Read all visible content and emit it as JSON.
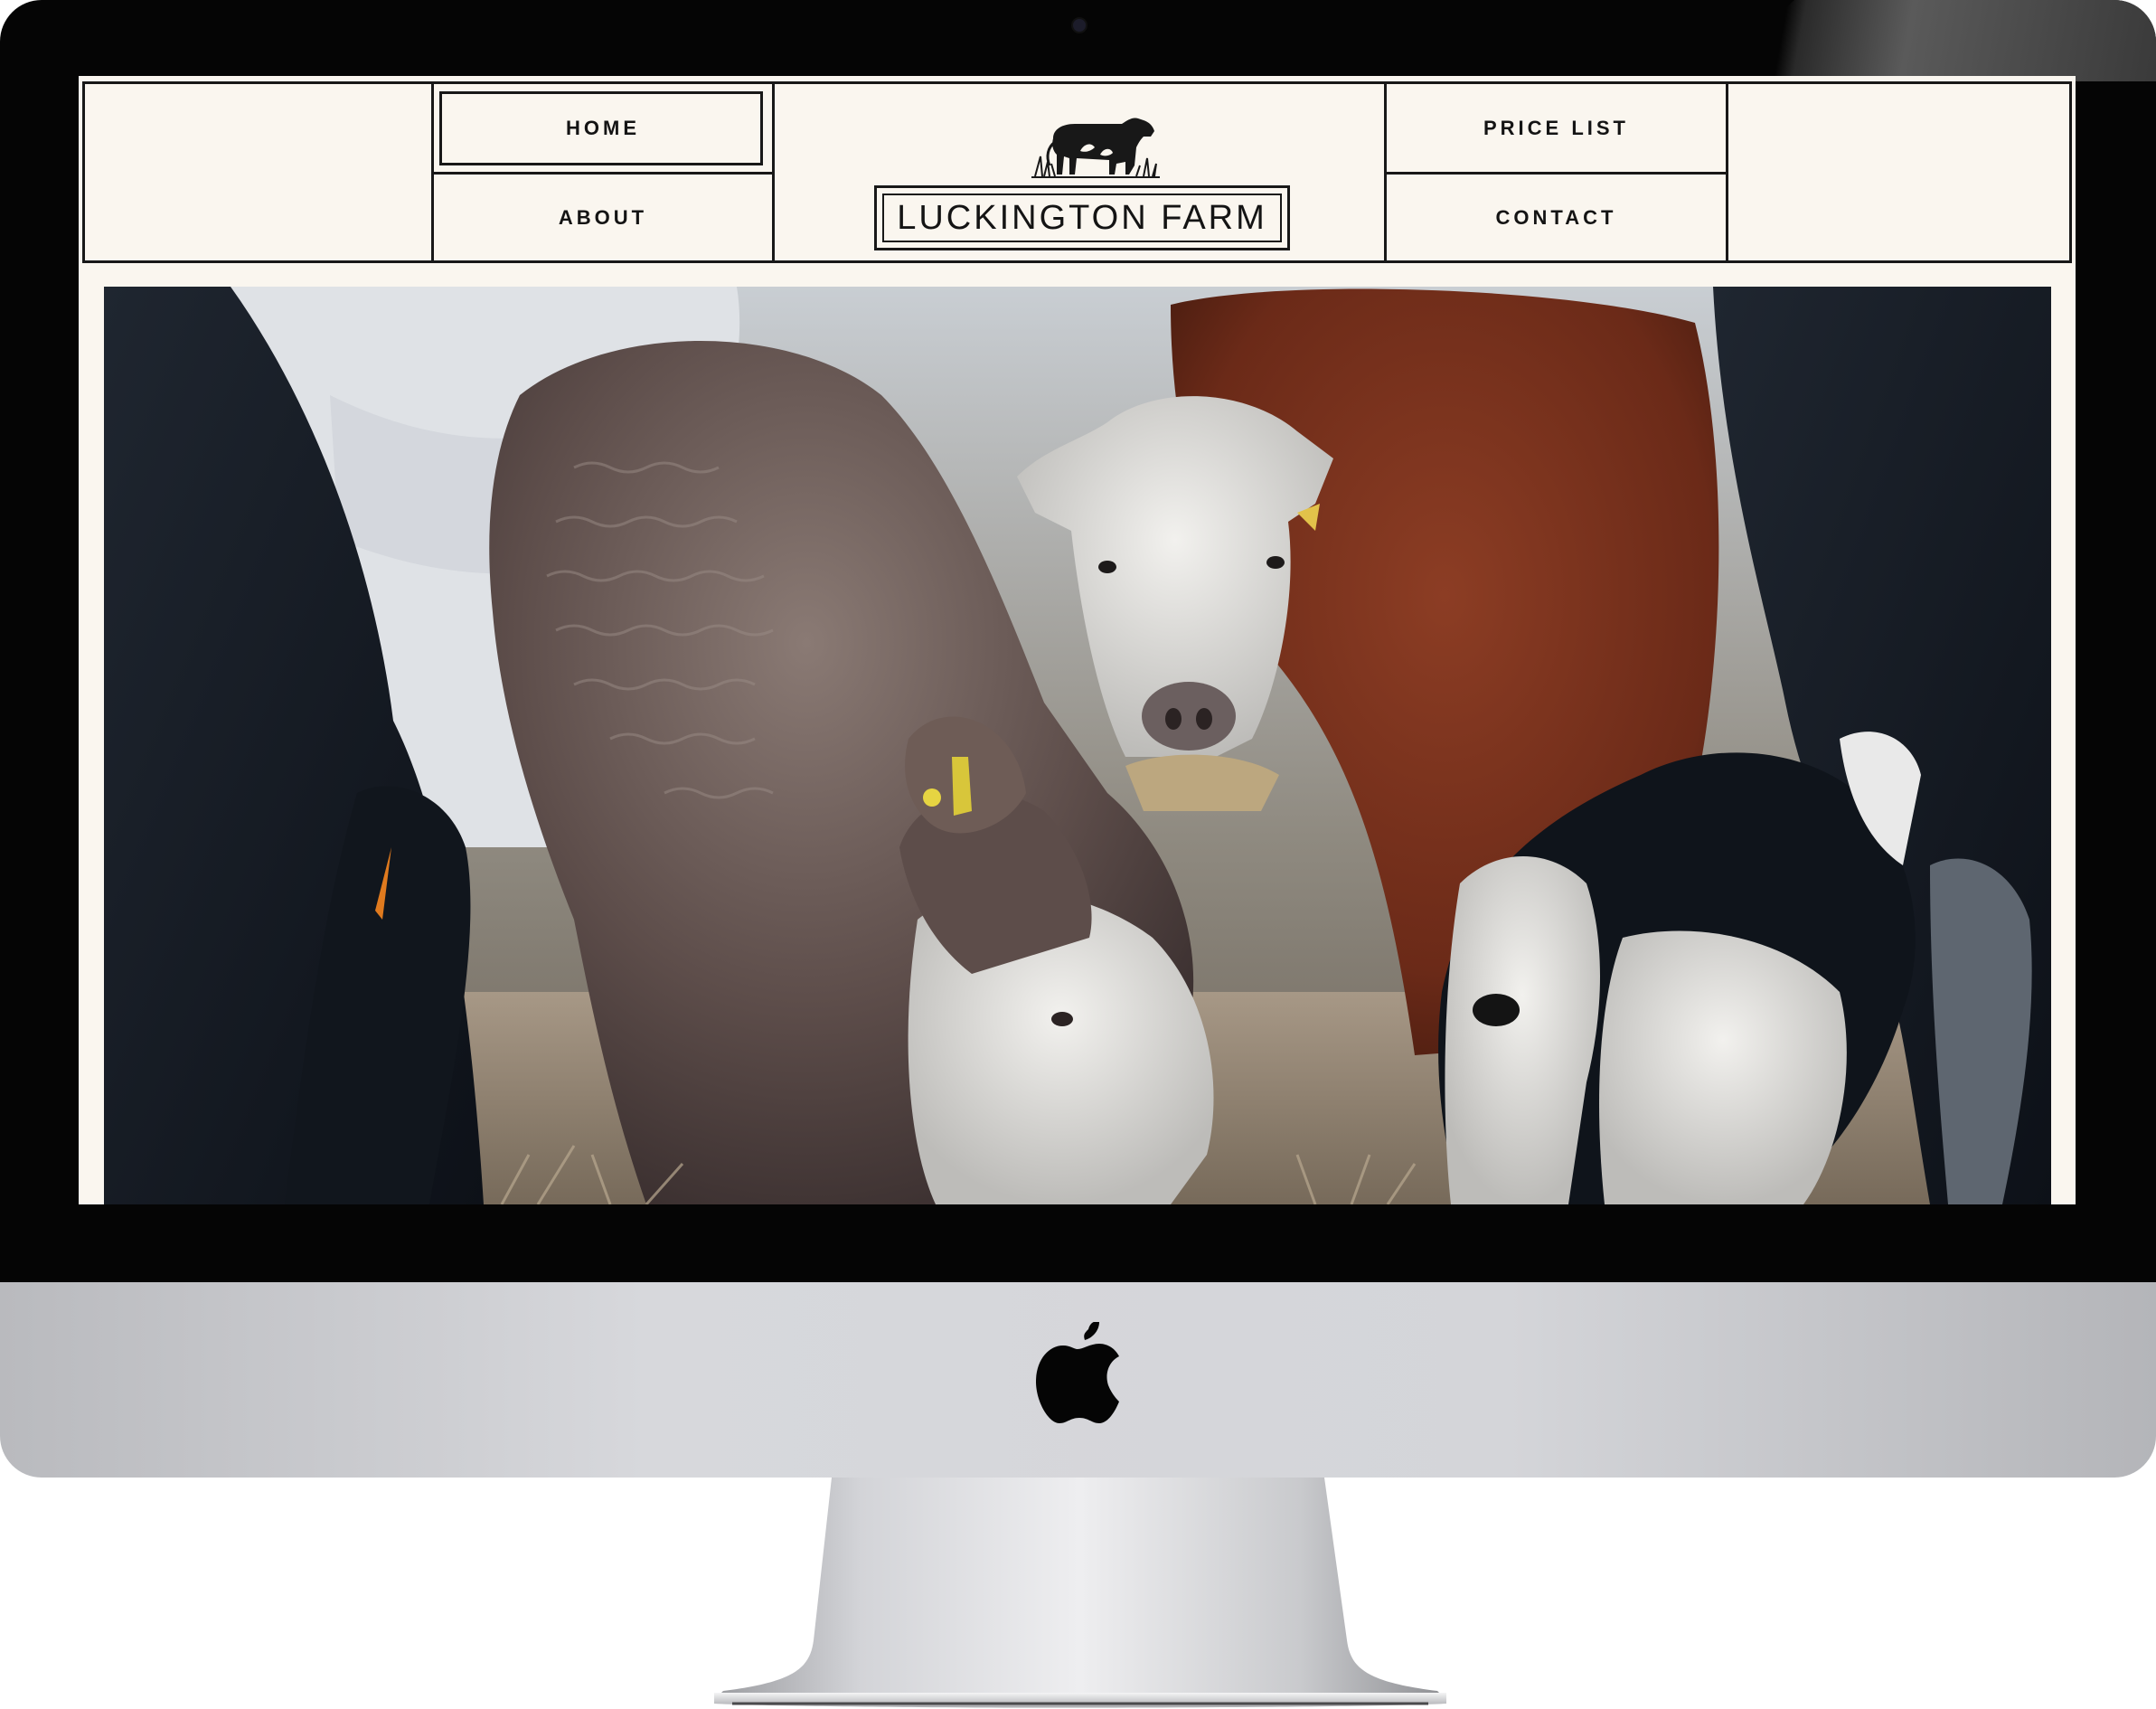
{
  "nav": {
    "home_label": "HOME",
    "about_label": "ABOUT",
    "price_list_label": "PRICE LIST",
    "contact_label": "CONTACT"
  },
  "brand": {
    "name": "LUCKINGTON FARM",
    "logo_icon": "cow-silhouette-icon"
  },
  "hero": {
    "image_icon": "grazing-cattle-photo"
  },
  "device": {
    "logo_icon": "apple-logo-icon"
  },
  "colors": {
    "page_background": "#faf6ef",
    "line_color": "#181818",
    "bezel": "#050505",
    "aluminium": "#d4d5d9"
  }
}
